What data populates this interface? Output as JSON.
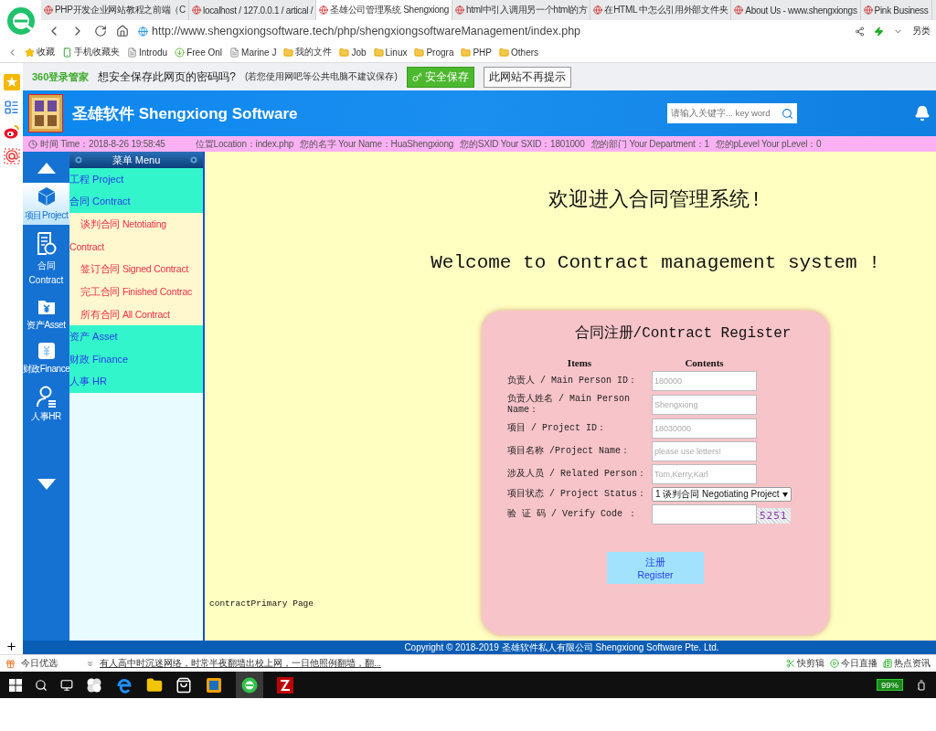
{
  "browser": {
    "tabs": [
      {
        "title": "PHP开发企业网站教程之前端（C",
        "selected": false
      },
      {
        "title": "localhost / 127.0.0.1 / artical /",
        "selected": false
      },
      {
        "title": "圣雄公司管理系统 Shengxiong",
        "selected": true
      },
      {
        "title": "html中引入调用另一个html的方",
        "selected": false
      },
      {
        "title": "在HTML 中怎么引用外部文件夹",
        "selected": false
      },
      {
        "title": "About Us - www.shengxiongs",
        "selected": false
      },
      {
        "title": "Pink Business",
        "selected": false
      }
    ],
    "address": "http://www.shengxiongsoftware.tech/php/shengxiongsoftwareManagement/index.php",
    "address_extra": "另类",
    "bookmarks": [
      {
        "label": "收藏",
        "kind": "star"
      },
      {
        "label": "手机收藏夹",
        "kind": "phone"
      },
      {
        "label": "Introdu",
        "kind": "page"
      },
      {
        "label": "Free Onl",
        "kind": "download"
      },
      {
        "label": "Marine J",
        "kind": "page"
      },
      {
        "label": "我的文件",
        "kind": "folder"
      },
      {
        "label": "Job",
        "kind": "folder"
      },
      {
        "label": "Linux",
        "kind": "folder"
      },
      {
        "label": "Progra",
        "kind": "folder"
      },
      {
        "label": "PHP",
        "kind": "folder"
      },
      {
        "label": "Others",
        "kind": "folder"
      }
    ]
  },
  "password_prompt": {
    "brand": "360登录管家",
    "question": "想安全保存此网页的密码吗?",
    "note": "(若您使用网吧等公共电脑不建议保存)",
    "buttons": [
      {
        "label": "安全保存",
        "kind": "primary"
      },
      {
        "label": "此网站不再提示",
        "kind": "plain"
      }
    ]
  },
  "header": {
    "title": "圣雄软件 Shengxiong Software",
    "search": {
      "placeholder": "请输入关键字... key word"
    }
  },
  "info_bar": {
    "time": "时间 Time：2018-8-26 19:58:45",
    "fields": [
      "位置Location：index.php",
      "您的名字 Your Name：HuaShengxiong",
      "您的SXID Your SXID：1801000",
      "您的部门 Your Department：1",
      "您的pLevel Your pLevel：0"
    ]
  },
  "nav": {
    "items": [
      {
        "label": "项目Project",
        "kind": "cube",
        "selected": true
      },
      {
        "label": "合同 Contract",
        "kind": "document",
        "selected": false
      },
      {
        "label": "资产Asset",
        "kind": "yen-folder",
        "selected": false
      },
      {
        "label": "财政Finance",
        "kind": "yen-card",
        "selected": false
      },
      {
        "label": "人事HR",
        "kind": "person",
        "selected": false
      }
    ]
  },
  "menu": {
    "title": "菜单 Menu",
    "items": [
      {
        "label": "工程 Project"
      },
      {
        "label": "合同 Contract",
        "expanded": true,
        "children": [
          {
            "label": "谈判合同 Netotiating Contract"
          },
          {
            "label": "签订合同 Signed Contract"
          },
          {
            "label": "完工合同 Finished Contrac"
          },
          {
            "label": "所有合同 All Contract"
          }
        ]
      },
      {
        "label": "资产 Asset"
      },
      {
        "label": "财政 Finance"
      },
      {
        "label": "人事 HR"
      }
    ]
  },
  "welcome": [
    "欢迎进入合同管理系统!",
    "Welcome to Contract management system !"
  ],
  "form": {
    "title": "合同注册/Contract Register",
    "columns": [
      "Items",
      "Contents"
    ],
    "rows": [
      {
        "label": "负责人 / Main Person ID：",
        "kind": "input",
        "placeholder": "180000"
      },
      {
        "label": "负责人姓名 / Main Person Name：",
        "kind": "input",
        "placeholder": "Shengxiong"
      },
      {
        "label": "项目 / Project ID：",
        "kind": "input",
        "placeholder": "18030000"
      },
      {
        "label": "项目名称 /Project Name：",
        "kind": "input",
        "placeholder": "please use letters!"
      },
      {
        "label": "涉及人员 / Related Person：",
        "kind": "input",
        "placeholder": "Tom,Kerry,Karl"
      },
      {
        "label": "项目状态 / Project Status：",
        "kind": "select",
        "value": "1 谈判合同 Negotiating Project"
      },
      {
        "label": "验 证 码 / Verify Code ：",
        "kind": "captcha",
        "captcha": "5251"
      }
    ],
    "submit": [
      "注册",
      "Register"
    ]
  },
  "page_name": "contractPrimary Page",
  "footer": "Copyright © 2018-2019 圣雄软件私人有限公司 Shengxiong Software Pte. Ltd.",
  "status_bar": {
    "label": "今日优选",
    "news": "有人高中时沉迷网络，时常半夜翻墙出校上网，一日他照例翻墙，翻...",
    "links": [
      "快剪辑",
      "今日直播",
      "热点资讯"
    ]
  },
  "taskbar": {
    "battery": "99%"
  }
}
